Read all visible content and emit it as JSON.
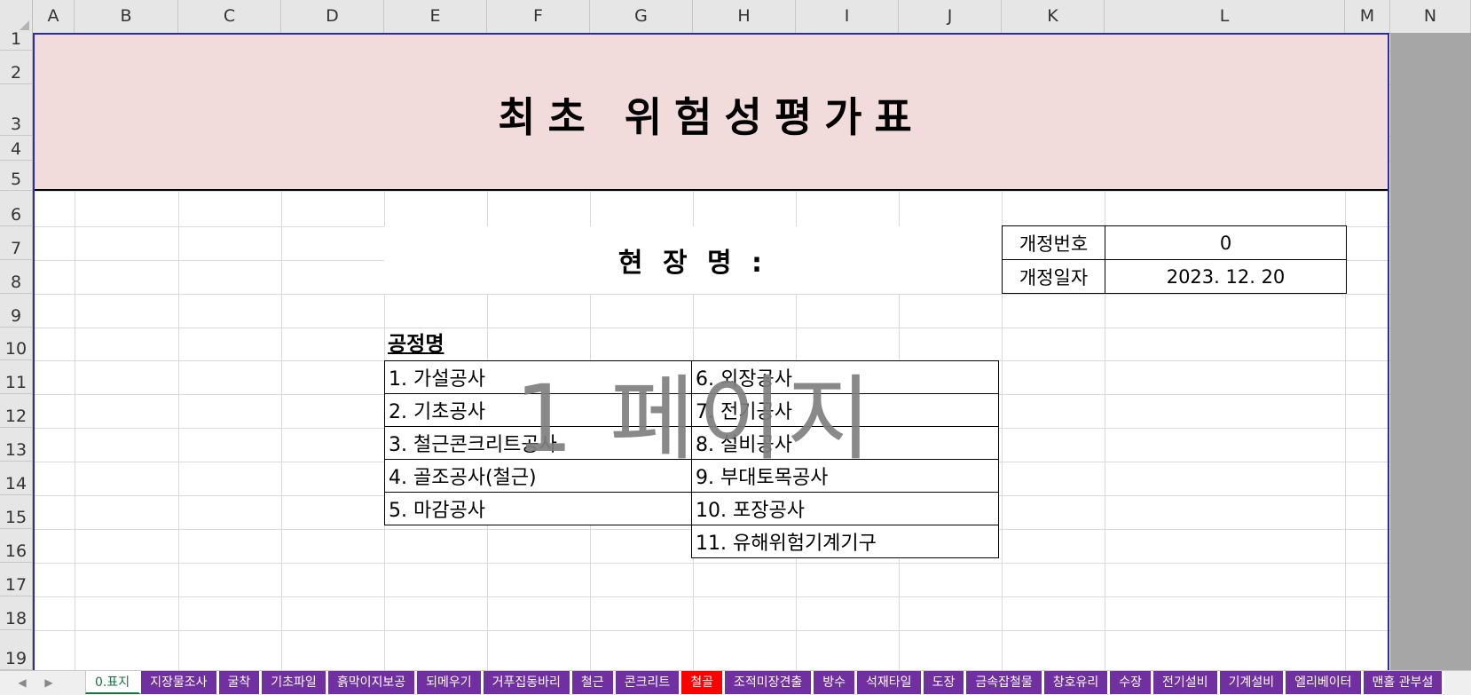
{
  "columns": [
    "A",
    "B",
    "C",
    "D",
    "E",
    "F",
    "G",
    "H",
    "I",
    "J",
    "K",
    "L",
    "M",
    "N"
  ],
  "rows": [
    "1",
    "2",
    "3",
    "4",
    "5",
    "6",
    "7",
    "8",
    "9",
    "10",
    "11",
    "12",
    "13",
    "14",
    "15",
    "16",
    "17",
    "18",
    "19"
  ],
  "title": "최초 위험성평가표",
  "site_name": "현 장 명 :",
  "revision": {
    "no_label": "개정번호",
    "no_value": "0",
    "date_label": "개정일자",
    "date_value": "2023. 12. 20"
  },
  "process": {
    "title": "공정명",
    "left": [
      "1. 가설공사",
      "2. 기초공사",
      "3. 철근콘크리트공사",
      "4. 골조공사(철근)",
      "5. 마감공사"
    ],
    "right": [
      "6. 외장공사",
      "7. 전기공사",
      "8. 설비공사",
      "9. 부대토목공사",
      "10. 포장공사",
      "11. 유해위험기계기구"
    ]
  },
  "watermark": "1 페이지",
  "tabs": [
    {
      "label": "0.표지",
      "state": "active"
    },
    {
      "label": "지장물조사",
      "state": "normal"
    },
    {
      "label": "굴착",
      "state": "normal"
    },
    {
      "label": "기초파일",
      "state": "normal"
    },
    {
      "label": "흙막이지보공",
      "state": "normal"
    },
    {
      "label": "되메우기",
      "state": "normal"
    },
    {
      "label": "거푸집동바리",
      "state": "normal"
    },
    {
      "label": "철근",
      "state": "normal"
    },
    {
      "label": "콘크리트",
      "state": "normal"
    },
    {
      "label": "철골",
      "state": "red"
    },
    {
      "label": "조적미장견출",
      "state": "normal"
    },
    {
      "label": "방수",
      "state": "normal"
    },
    {
      "label": "석재타일",
      "state": "normal"
    },
    {
      "label": "도장",
      "state": "normal"
    },
    {
      "label": "금속잡철물",
      "state": "normal"
    },
    {
      "label": "창호유리",
      "state": "normal"
    },
    {
      "label": "수장",
      "state": "normal"
    },
    {
      "label": "전기설비",
      "state": "normal"
    },
    {
      "label": "기계설비",
      "state": "normal"
    },
    {
      "label": "엘리베이터",
      "state": "normal"
    },
    {
      "label": "맨홀 관부설",
      "state": "normal"
    }
  ],
  "colors": {
    "title_band": "#f2dcdb",
    "tab_normal": "#7030a0",
    "tab_red": "#ff0000",
    "print_border": "#2a2ab5",
    "outside_area": "#a6a6a6"
  },
  "icons": [
    "scroll-left-icon",
    "scroll-right-icon"
  ]
}
